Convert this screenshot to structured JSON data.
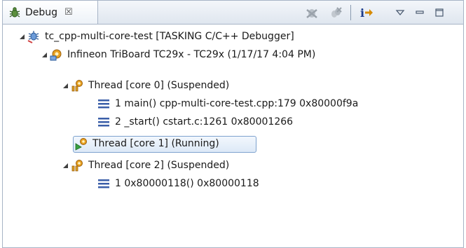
{
  "tab": {
    "title": "Debug",
    "close_glyph": "☒",
    "icon": "debug-bug-icon"
  },
  "toolbar": {
    "items": [
      "remove-terminated-icon",
      "remove-all-terminated-icon",
      "step-into-icon",
      "view-menu-icon",
      "minimize-icon",
      "maximize-icon"
    ]
  },
  "tree": {
    "launch": {
      "label": "tc_cpp-multi-core-test [TASKING C/C++ Debugger]"
    },
    "target": {
      "label": "Infineon TriBoard TC29x - TC29x (1/17/17 4:04 PM)"
    },
    "thread0": {
      "label": "Thread [core 0] (Suspended)",
      "frames": [
        {
          "label": "1 main() cpp-multi-core-test.cpp:179 0x80000f9a"
        },
        {
          "label": "2 _start() cstart.c:1261 0x80001266"
        }
      ]
    },
    "thread1": {
      "label": "Thread [core 1] (Running)"
    },
    "thread2": {
      "label": "Thread [core 2] (Suspended)",
      "frames": [
        {
          "label": "1 0x80000118()  0x80000118"
        }
      ]
    }
  },
  "colors": {
    "selection_border": "#7da2ce",
    "tab_border": "#a7b4c6",
    "frame_icon": "#3a5ea8"
  }
}
